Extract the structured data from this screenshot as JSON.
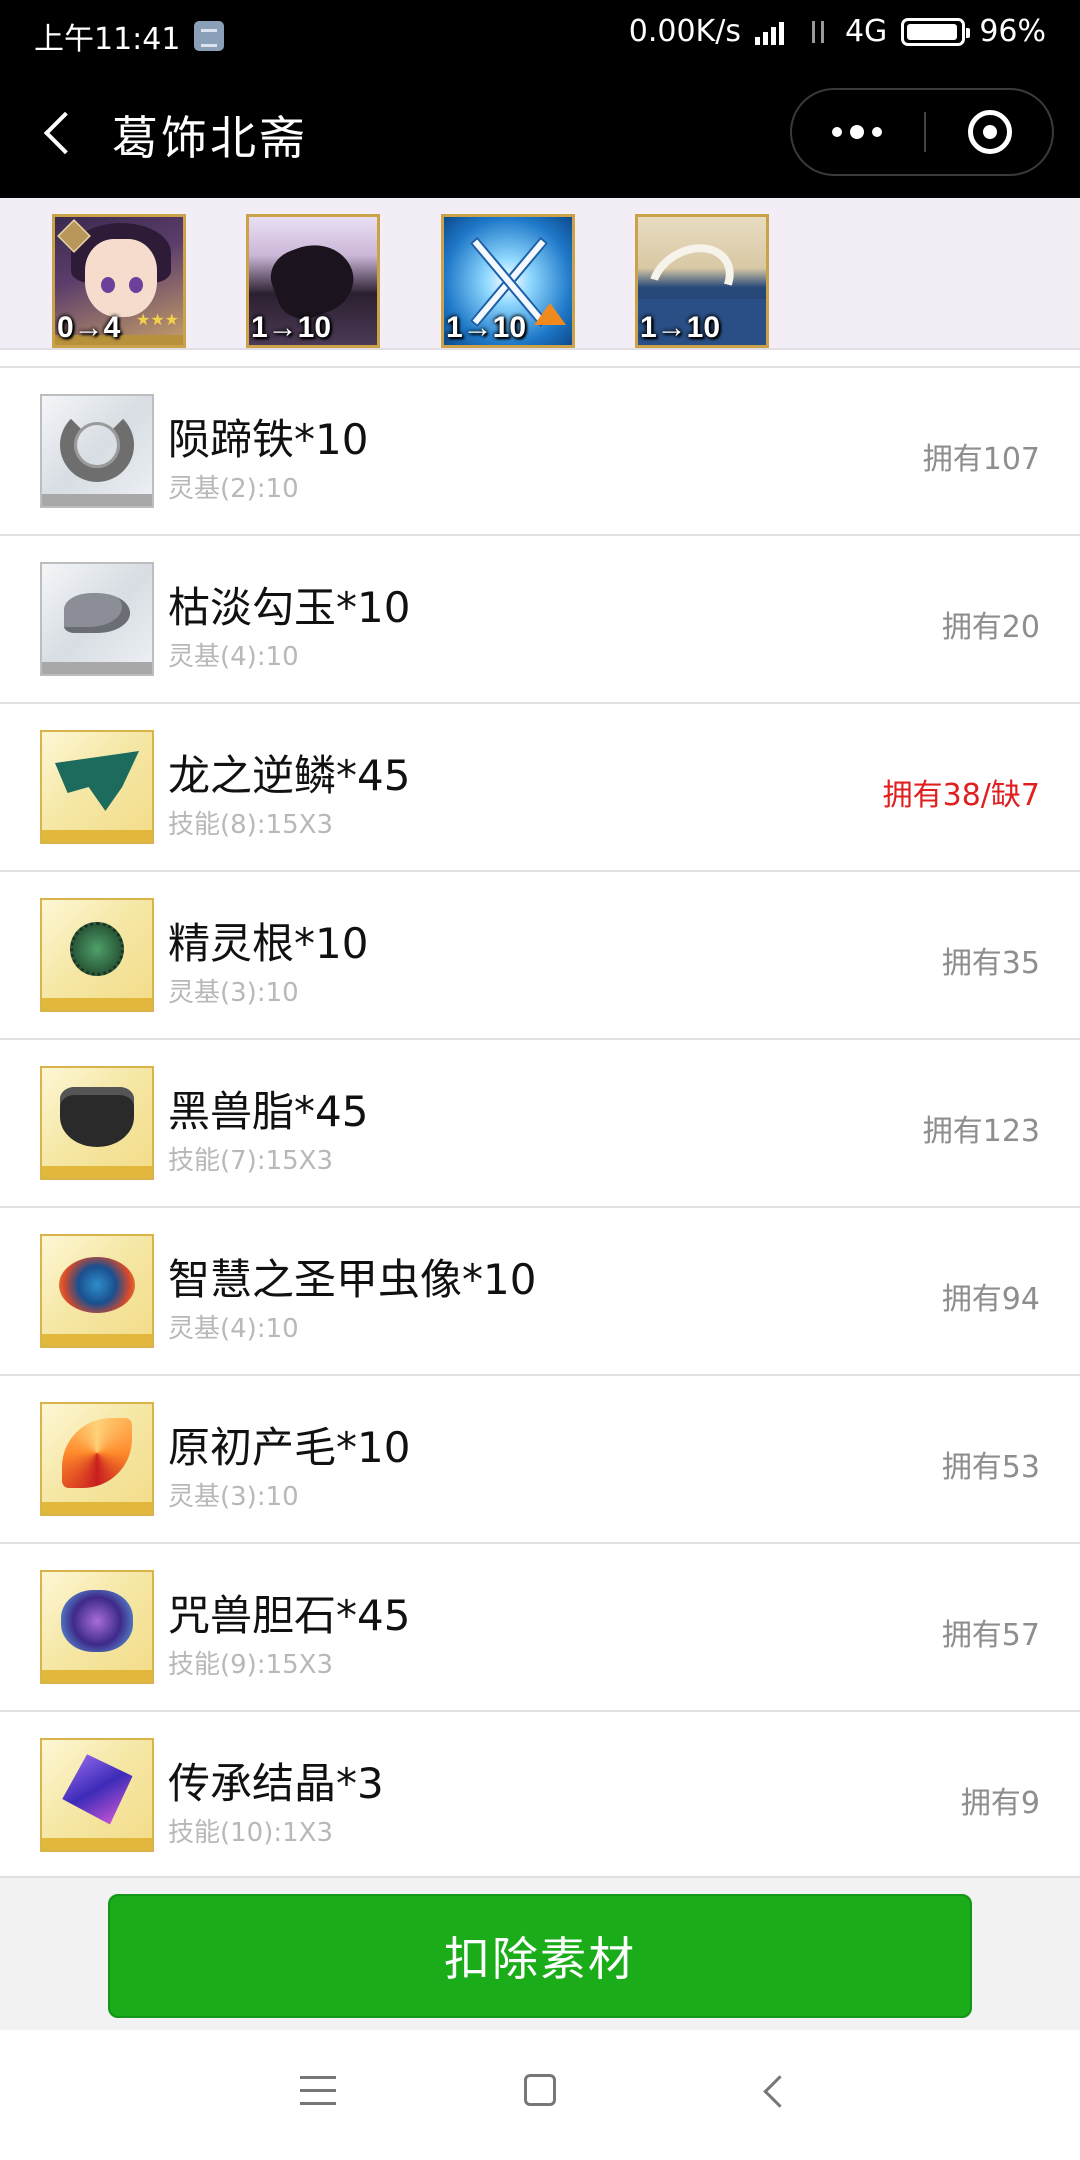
{
  "status_bar": {
    "time": "上午11:41",
    "net_speed": "0.00K/s",
    "signal_hd": "HD",
    "network": "4G",
    "battery": "96%"
  },
  "nav": {
    "title": "葛饰北斋"
  },
  "cards": [
    {
      "level": "0→4",
      "kind": "servant"
    },
    {
      "level": "1→10",
      "kind": "skill-1"
    },
    {
      "level": "1→10",
      "kind": "skill-2"
    },
    {
      "level": "1→10",
      "kind": "skill-3"
    }
  ],
  "items": [
    {
      "name": "陨蹄铁*10",
      "detail": "灵基(2):10",
      "owned": "拥有107",
      "icon": "horseshoe-icon",
      "short": false
    },
    {
      "name": "枯淡勾玉*10",
      "detail": "灵基(4):10",
      "owned": "拥有20",
      "icon": "magatama-icon",
      "short": false
    },
    {
      "name": "龙之逆鳞*45",
      "detail": "技能(8):15X3",
      "owned": "拥有38/缺7",
      "icon": "dragon-scale-icon",
      "short": true
    },
    {
      "name": "精灵根*10",
      "detail": "灵基(3):10",
      "owned": "拥有35",
      "icon": "spirit-root-icon",
      "short": false
    },
    {
      "name": "黑兽脂*45",
      "detail": "技能(7):15X3",
      "owned": "拥有123",
      "icon": "cauldron-icon",
      "short": false
    },
    {
      "name": "智慧之圣甲虫像*10",
      "detail": "灵基(4):10",
      "owned": "拥有94",
      "icon": "scarab-icon",
      "short": false
    },
    {
      "name": "原初产毛*10",
      "detail": "灵基(3):10",
      "owned": "拥有53",
      "icon": "feather-icon",
      "short": false
    },
    {
      "name": "咒兽胆石*45",
      "detail": "技能(9):15X3",
      "owned": "拥有57",
      "icon": "gallstone-icon",
      "short": false
    },
    {
      "name": "传承结晶*3",
      "detail": "技能(10):1X3",
      "owned": "拥有9",
      "icon": "crystal-icon",
      "short": false
    }
  ],
  "action": {
    "deduct_label": "扣除素材"
  },
  "colors": {
    "primary_button": "#1aad19",
    "shortage_text": "#e02020"
  }
}
